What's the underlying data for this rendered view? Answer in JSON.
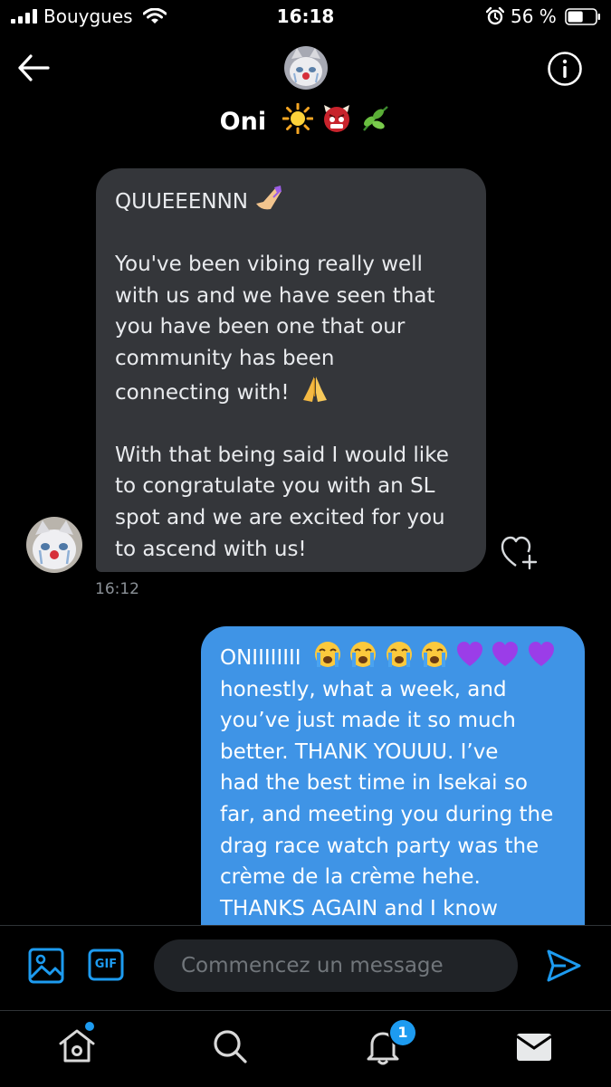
{
  "status_bar": {
    "carrier": "Bouygues",
    "time": "16:18",
    "battery_percent": "56 %",
    "battery_level": 0.56
  },
  "header": {
    "contact_name": "Oni",
    "contact_emojis": [
      "sun",
      "ogre",
      "herb"
    ],
    "back_icon": "arrow-left-icon",
    "info_icon": "info-icon"
  },
  "messages": [
    {
      "direction": "received",
      "paragraphs": [
        [
          "QUUEEENNN"
        ],
        [
          "You've been vibing really well",
          "with us and we have seen that",
          "you have been one that our",
          "community has been",
          "connecting with!"
        ],
        [
          "With that being said I would like",
          "to congratulate you with an SL",
          "spot and we are excited for you",
          "to ascend with us!"
        ]
      ],
      "time": "16:12"
    },
    {
      "direction": "sent",
      "lines": [
        "ONIIIIIIII",
        "honestly, what a week, and",
        "you’ve just made it so much",
        "better. THANK YOUUU. I’ve",
        "had the best time in Isekai so",
        "far, and meeting you during the",
        "drag race watch party was the",
        "crème de la crème hehe.",
        "THANKS AGAIN and I know"
      ]
    }
  ],
  "composer": {
    "placeholder": "Commencez un message",
    "gif_label": "GIF"
  },
  "tabbar": {
    "notifications_badge": "1"
  },
  "colors": {
    "sent_bubble": "#3f94e6",
    "received_bubble": "#34363a",
    "accent": "#1d9bf0",
    "background": "#000000"
  }
}
